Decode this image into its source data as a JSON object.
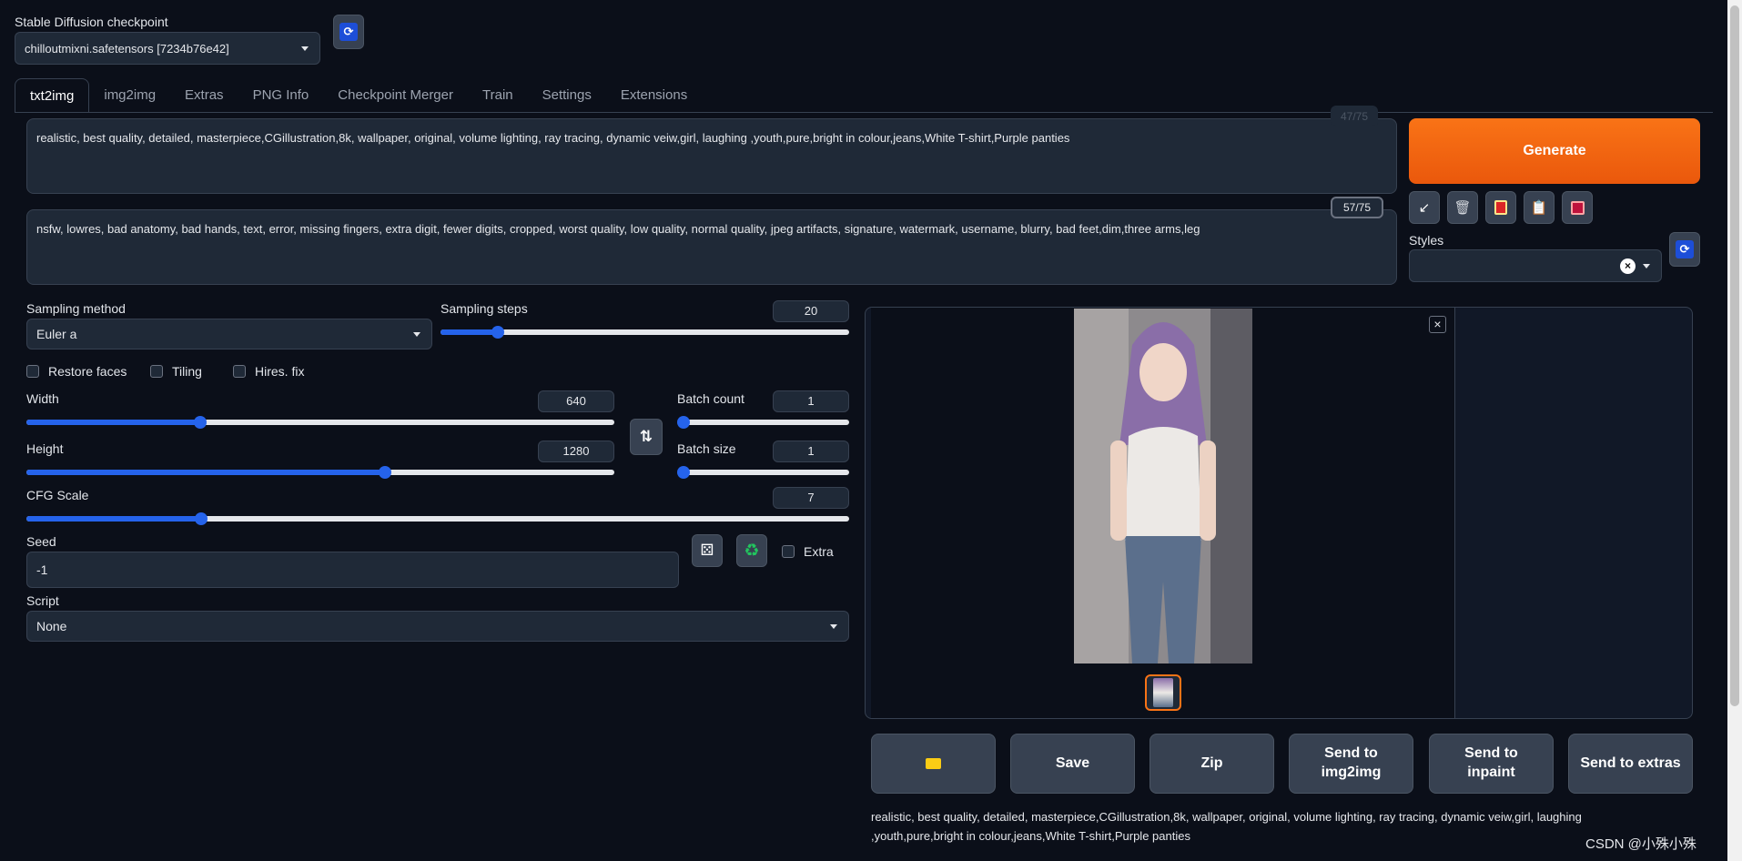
{
  "checkpoint": {
    "label": "Stable Diffusion checkpoint",
    "value": "chilloutmixni.safetensors [7234b76e42]"
  },
  "tabs": [
    {
      "label": "txt2img"
    },
    {
      "label": "img2img"
    },
    {
      "label": "Extras"
    },
    {
      "label": "PNG Info"
    },
    {
      "label": "Checkpoint Merger"
    },
    {
      "label": "Train"
    },
    {
      "label": "Settings"
    },
    {
      "label": "Extensions"
    }
  ],
  "prompt": {
    "positive": "realistic, best quality, detailed, masterpiece,CGillustration,8k, wallpaper, original, volume lighting, ray tracing, dynamic veiw,girl, laughing ,youth,pure,bright in colour,jeans,White T-shirt,Purple panties",
    "positive_counter": "47/75",
    "negative": "nsfw, lowres, bad anatomy, bad hands, text, error, missing fingers, extra digit, fewer digits, cropped, worst quality, low quality, normal quality, jpeg artifacts, signature, watermark, username, blurry, bad feet,dim,three arms,leg",
    "negative_counter": "57/75"
  },
  "generate_label": "Generate",
  "styles_label": "Styles",
  "sampling": {
    "method_label": "Sampling method",
    "method_value": "Euler a",
    "steps_label": "Sampling steps",
    "steps_value": "20",
    "steps_fraction": 0.14
  },
  "checkboxes": {
    "restore_faces": "Restore faces",
    "tiling": "Tiling",
    "hires_fix": "Hires. fix",
    "extra": "Extra"
  },
  "width": {
    "label": "Width",
    "value": "640",
    "fraction": 0.295
  },
  "height": {
    "label": "Height",
    "value": "1280",
    "fraction": 0.61
  },
  "batch_count": {
    "label": "Batch count",
    "value": "1",
    "fraction": 0.0
  },
  "batch_size": {
    "label": "Batch size",
    "value": "1",
    "fraction": 0.0
  },
  "cfg": {
    "label": "CFG Scale",
    "value": "7",
    "fraction": 0.212
  },
  "seed": {
    "label": "Seed",
    "value": "-1"
  },
  "script": {
    "label": "Script",
    "value": "None"
  },
  "actions": {
    "save": "Save",
    "zip": "Zip",
    "send_img2img": "Send to img2img",
    "send_inpaint": "Send to inpaint",
    "send_extras": "Send to extras"
  },
  "info_text": "realistic, best quality, detailed, masterpiece,CGillustration,8k, wallpaper, original, volume lighting, ray tracing, dynamic veiw,girl, laughing ,youth,pure,bright in colour,jeans,White T-shirt,Purple panties",
  "watermark": "CSDN @小殊小殊",
  "colors": {
    "background": "#0b0f19",
    "accent": "#2563eb",
    "generate": "#f97316"
  }
}
